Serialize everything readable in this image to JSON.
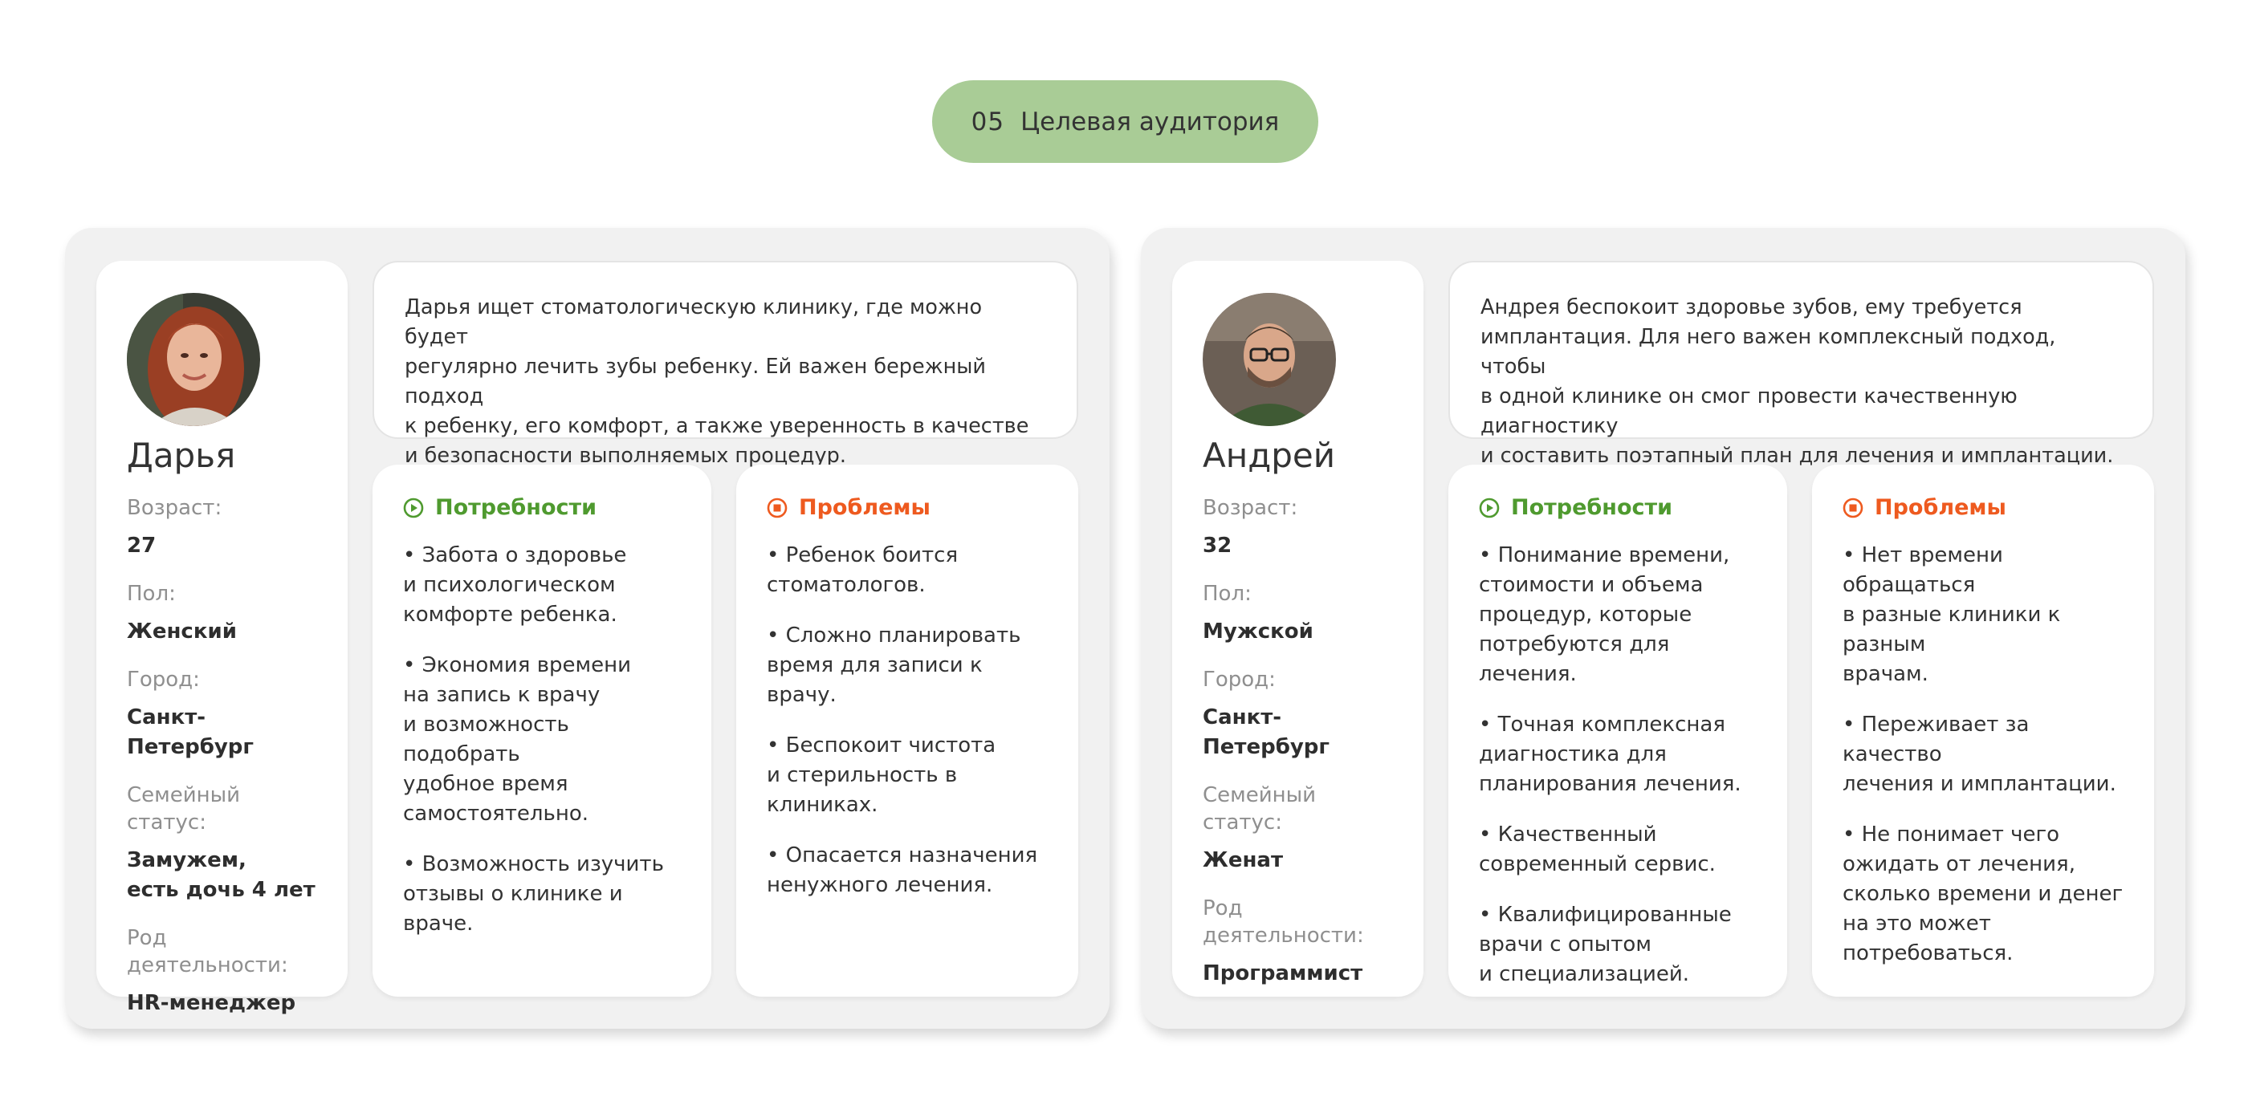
{
  "section": {
    "number": "05",
    "title": "Целевая аудитория",
    "color": "#a9cc96"
  },
  "labels": {
    "age": "Возраст:",
    "gender": "Пол:",
    "city": "Город:",
    "family": "Семейный статус:",
    "occupation": "Род деятельности:",
    "needs": "Потребности",
    "problems": "Проблемы"
  },
  "colors": {
    "needs": "#4f9a2f",
    "problems": "#ee5a1f"
  },
  "personas": [
    {
      "name": "Дарья",
      "avatar_icon": "woman-portrait",
      "age": "27",
      "gender": "Женский",
      "city": "Санкт-Петербург",
      "family": "Замужем,\nесть дочь 4 лет",
      "occupation": "HR-менеджер",
      "description": "Дарья ищет стоматологическую клинику, где можно будет\nрегулярно лечить зубы ребенку. Ей важен бережный подход\nк ребенку, его комфорт, а также уверенность в качестве\nи безопасности выполняемых процедур.",
      "needs": [
        "• Забота о здоровье\nи психологическом\nкомфорте ребенка.",
        "• Экономия времени\nна запись к врачу\nи возможность подобрать\nудобное время\nсамостоятельно.",
        "• Возможность изучить\nотзывы о клинике и враче."
      ],
      "problems": [
        "• Ребенок боится\nстоматологов.",
        "• Сложно планировать\nвремя для записи к врачу.",
        "• Беспокоит чистота\nи стерильность в клиниках.",
        "• Опасается назначения\nненужного лечения."
      ]
    },
    {
      "name": "Андрей",
      "avatar_icon": "man-portrait",
      "age": "32",
      "gender": "Мужской",
      "city": "Санкт-Петербург",
      "family": "Женат",
      "occupation": "Программист",
      "description": "Андрея беспокоит здоровье зубов, ему требуется\nимплантация. Для него важен комплексный подход, чтобы\nв одной клинике он смог провести качественную диагностику\nи составить поэтапный план для лечения и имплантации.",
      "needs": [
        "• Понимание времени,\nстоимости и объема\nпроцедур, которые\nпотребуются для лечения.",
        "• Точная комплексная\nдиагностика для\nпланирования лечения.",
        "• Качественный\nсовременный сервис.",
        "• Квалифицированные\nврачи с опытом\nи специализацией."
      ],
      "problems": [
        "• Нет времени обращаться\nв разные клиники к разным\nврачам.",
        "• Переживает за качество\nлечения и имплантации.",
        "• Не понимает чего\nожидать от лечения,\nсколько времени и денег\nна это может\nпотребоваться."
      ]
    }
  ]
}
